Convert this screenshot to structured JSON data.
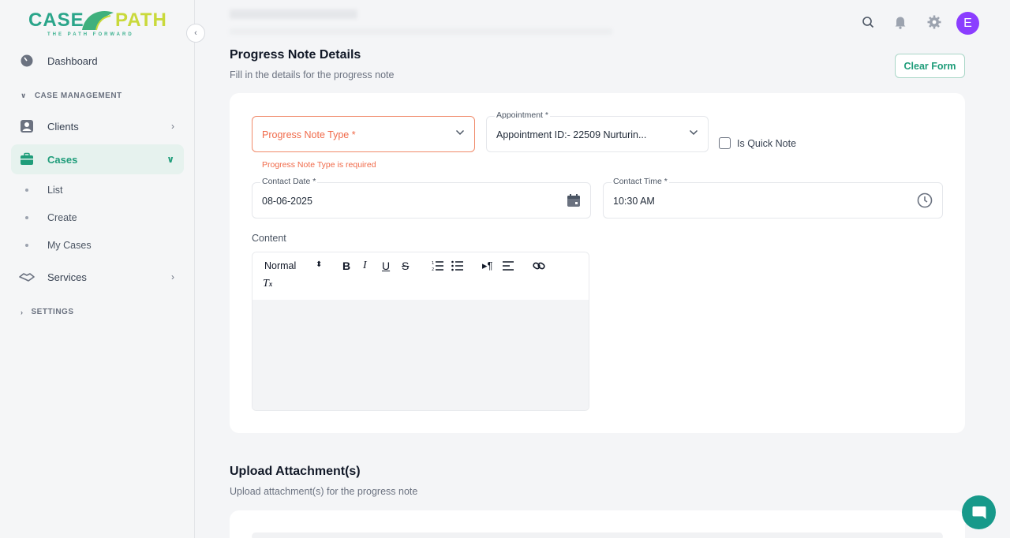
{
  "brand": {
    "name_left": "CASE",
    "name_right": "PATH",
    "tagline": "THE PATH FORWARD"
  },
  "sidebar": {
    "items": [
      {
        "label": "Dashboard",
        "icon": "dashboard-icon"
      },
      {
        "label": "Clients",
        "icon": "user-icon"
      },
      {
        "label": "Cases",
        "icon": "briefcase-icon",
        "active": true
      },
      {
        "label": "Services",
        "icon": "handshake-icon"
      }
    ],
    "section_case_management": "CASE MANAGEMENT",
    "section_settings": "SETTINGS",
    "cases_sub": [
      "List",
      "Create",
      "My Cases"
    ]
  },
  "topbar": {
    "avatar_initial": "E",
    "icons": [
      "search-icon",
      "bell-icon",
      "gear-icon"
    ]
  },
  "page": {
    "title": "Progress Note Details",
    "subtitle": "Fill in the details for the progress note",
    "clear_button": "Clear Form"
  },
  "form": {
    "progress_note_type": {
      "placeholder": "Progress Note Type *",
      "error": "Progress Note Type is required"
    },
    "appointment": {
      "label": "Appointment *",
      "value": "Appointment ID:- 22509 Nurturin..."
    },
    "quick_note": {
      "label": "Is Quick Note",
      "checked": false
    },
    "contact_date": {
      "label": "Contact Date *",
      "value": "08-06-2025"
    },
    "contact_time": {
      "label": "Contact Time *",
      "value": "10:30 AM"
    },
    "content": {
      "label": "Content",
      "format_select": "Normal",
      "toolbar": [
        "bold",
        "italic",
        "underline",
        "strike",
        "ordered-list",
        "bullet-list",
        "rtl",
        "align",
        "link",
        "clear-format"
      ]
    }
  },
  "upload": {
    "title": "Upload Attachment(s)",
    "subtitle": "Upload attachment(s) for the progress note"
  },
  "colors": {
    "accent": "#1f9d7a",
    "error": "#f06a4a",
    "avatar": "#8b3dff"
  }
}
